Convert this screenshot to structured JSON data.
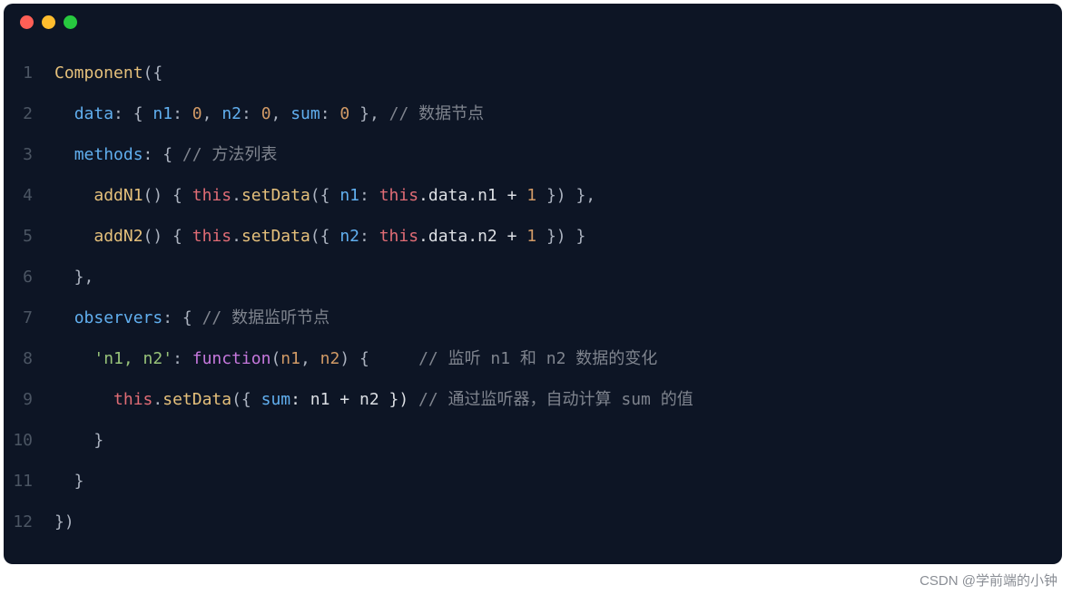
{
  "window": {
    "dots": [
      "red",
      "yellow",
      "green"
    ]
  },
  "code": {
    "lines": [
      {
        "n": "1",
        "tokens": [
          {
            "t": "Component",
            "c": "tok-call"
          },
          {
            "t": "({",
            "c": "tok-punct"
          }
        ]
      },
      {
        "n": "2",
        "tokens": [
          {
            "t": "  ",
            "c": "tok-plain"
          },
          {
            "t": "data",
            "c": "tok-prop"
          },
          {
            "t": ": { ",
            "c": "tok-punct"
          },
          {
            "t": "n1",
            "c": "tok-prop"
          },
          {
            "t": ": ",
            "c": "tok-punct"
          },
          {
            "t": "0",
            "c": "tok-num"
          },
          {
            "t": ", ",
            "c": "tok-punct"
          },
          {
            "t": "n2",
            "c": "tok-prop"
          },
          {
            "t": ": ",
            "c": "tok-punct"
          },
          {
            "t": "0",
            "c": "tok-num"
          },
          {
            "t": ", ",
            "c": "tok-punct"
          },
          {
            "t": "sum",
            "c": "tok-prop"
          },
          {
            "t": ": ",
            "c": "tok-punct"
          },
          {
            "t": "0",
            "c": "tok-num"
          },
          {
            "t": " }, ",
            "c": "tok-punct"
          },
          {
            "t": "// 数据节点",
            "c": "tok-comm"
          }
        ]
      },
      {
        "n": "3",
        "tokens": [
          {
            "t": "  ",
            "c": "tok-plain"
          },
          {
            "t": "methods",
            "c": "tok-prop"
          },
          {
            "t": ": { ",
            "c": "tok-punct"
          },
          {
            "t": "// 方法列表",
            "c": "tok-comm"
          }
        ]
      },
      {
        "n": "4",
        "tokens": [
          {
            "t": "    ",
            "c": "tok-plain"
          },
          {
            "t": "addN1",
            "c": "tok-call"
          },
          {
            "t": "() { ",
            "c": "tok-punct"
          },
          {
            "t": "this",
            "c": "tok-this"
          },
          {
            "t": ".",
            "c": "tok-punct"
          },
          {
            "t": "setData",
            "c": "tok-call"
          },
          {
            "t": "({ ",
            "c": "tok-punct"
          },
          {
            "t": "n1",
            "c": "tok-prop"
          },
          {
            "t": ": ",
            "c": "tok-punct"
          },
          {
            "t": "this",
            "c": "tok-this"
          },
          {
            "t": ".data.n1 + ",
            "c": "tok-plain"
          },
          {
            "t": "1",
            "c": "tok-num"
          },
          {
            "t": " }) },",
            "c": "tok-punct"
          }
        ]
      },
      {
        "n": "5",
        "tokens": [
          {
            "t": "    ",
            "c": "tok-plain"
          },
          {
            "t": "addN2",
            "c": "tok-call"
          },
          {
            "t": "() { ",
            "c": "tok-punct"
          },
          {
            "t": "this",
            "c": "tok-this"
          },
          {
            "t": ".",
            "c": "tok-punct"
          },
          {
            "t": "setData",
            "c": "tok-call"
          },
          {
            "t": "({ ",
            "c": "tok-punct"
          },
          {
            "t": "n2",
            "c": "tok-prop"
          },
          {
            "t": ": ",
            "c": "tok-punct"
          },
          {
            "t": "this",
            "c": "tok-this"
          },
          {
            "t": ".data.n2 + ",
            "c": "tok-plain"
          },
          {
            "t": "1",
            "c": "tok-num"
          },
          {
            "t": " }) }",
            "c": "tok-punct"
          }
        ]
      },
      {
        "n": "6",
        "tokens": [
          {
            "t": "  },",
            "c": "tok-punct"
          }
        ]
      },
      {
        "n": "7",
        "tokens": [
          {
            "t": "  ",
            "c": "tok-plain"
          },
          {
            "t": "observers",
            "c": "tok-prop"
          },
          {
            "t": ": { ",
            "c": "tok-punct"
          },
          {
            "t": "// 数据监听节点",
            "c": "tok-comm"
          }
        ]
      },
      {
        "n": "8",
        "tokens": [
          {
            "t": "    ",
            "c": "tok-plain"
          },
          {
            "t": "'n1, n2'",
            "c": "tok-str"
          },
          {
            "t": ": ",
            "c": "tok-punct"
          },
          {
            "t": "function",
            "c": "tok-key"
          },
          {
            "t": "(",
            "c": "tok-punct"
          },
          {
            "t": "n1",
            "c": "tok-num"
          },
          {
            "t": ", ",
            "c": "tok-punct"
          },
          {
            "t": "n2",
            "c": "tok-num"
          },
          {
            "t": ") {     ",
            "c": "tok-punct"
          },
          {
            "t": "// 监听 n1 和 n2 数据的变化",
            "c": "tok-comm"
          }
        ]
      },
      {
        "n": "9",
        "tokens": [
          {
            "t": "      ",
            "c": "tok-plain"
          },
          {
            "t": "this",
            "c": "tok-this"
          },
          {
            "t": ".",
            "c": "tok-punct"
          },
          {
            "t": "setData",
            "c": "tok-call"
          },
          {
            "t": "({ ",
            "c": "tok-punct"
          },
          {
            "t": "sum",
            "c": "tok-prop"
          },
          {
            "t": ": n1 + n2 }) ",
            "c": "tok-plain"
          },
          {
            "t": "// 通过监听器，自动计算 sum 的值",
            "c": "tok-comm"
          }
        ]
      },
      {
        "n": "10",
        "tokens": [
          {
            "t": "    }",
            "c": "tok-punct"
          }
        ]
      },
      {
        "n": "11",
        "tokens": [
          {
            "t": "  }",
            "c": "tok-punct"
          }
        ]
      },
      {
        "n": "12",
        "tokens": [
          {
            "t": "})",
            "c": "tok-punct"
          }
        ]
      }
    ]
  },
  "watermark": "CSDN @学前端的小钟"
}
